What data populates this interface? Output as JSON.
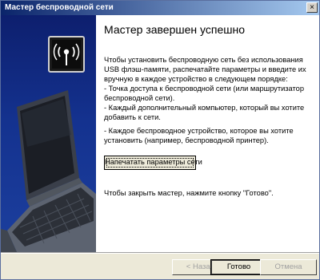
{
  "window": {
    "title": "Мастер беспроводной сети",
    "close_symbol": "×"
  },
  "content": {
    "heading": "Мастер завершен успешно",
    "intro": "Чтобы установить беспроводную сеть без использования USB флэш-памяти, распечатайте параметры и введите их вручную в каждое устройство в следующем порядке:",
    "bullets": [
      "- Точка доступа к беспроводной сети (или маршрутизатор беспроводной сети).",
      "- Каждый дополнительный компьютер, который вы хотите добавить к сети.",
      "- Каждое беспроводное устройство, которое вы хотите установить (например, беспроводной принтер)."
    ],
    "print_button": "Напечатать параметры сети",
    "close_hint": "Чтобы закрыть мастер, нажмите кнопку \"Готово\"."
  },
  "buttons": {
    "back": "< Назад",
    "finish": "Готово",
    "cancel": "Отмена"
  },
  "icons": {
    "side_illustration": "laptop-icon",
    "wireless": "wireless-antenna-icon"
  }
}
